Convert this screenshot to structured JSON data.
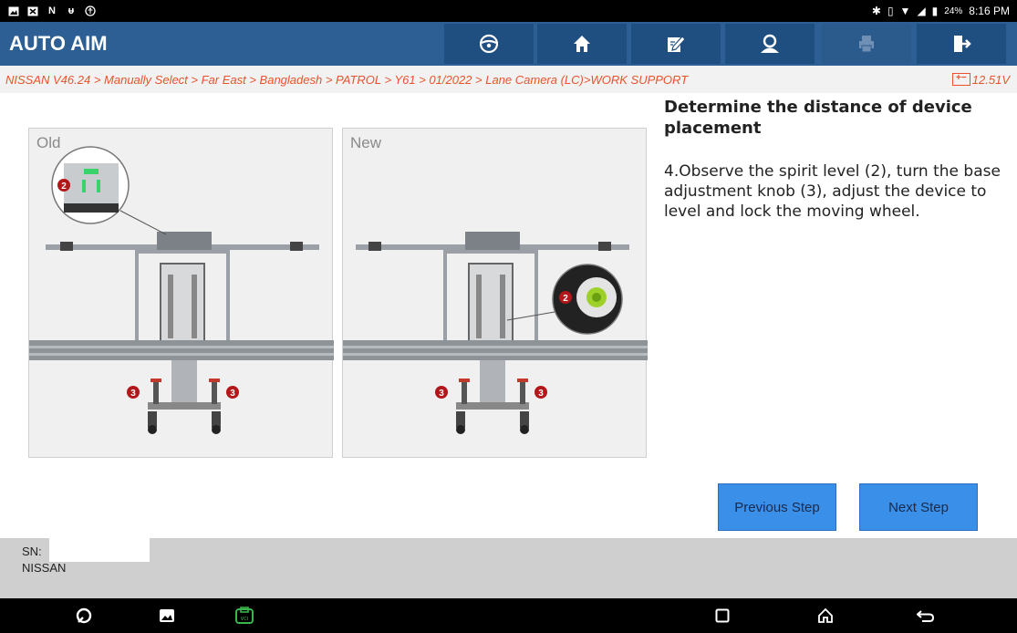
{
  "status_bar": {
    "left_icons": [
      "gallery-icon",
      "app-icon",
      "n-icon",
      "usb-icon",
      "accessibility-icon"
    ],
    "battery_percent": "24%",
    "time": "8:16 PM"
  },
  "header": {
    "title": "AUTO AIM",
    "toolbar": [
      {
        "name": "steering-wheel-icon",
        "enabled": true
      },
      {
        "name": "home-icon",
        "enabled": true
      },
      {
        "name": "edit-icon",
        "enabled": true
      },
      {
        "name": "user-icon",
        "enabled": true
      },
      {
        "name": "print-icon",
        "enabled": false
      },
      {
        "name": "exit-icon",
        "enabled": true
      }
    ]
  },
  "breadcrumb": {
    "path": "NISSAN V46.24 > Manually Select > Far East > Bangladesh > PATROL > Y61 > 01/2022 > Lane Camera (LC)>WORK SUPPORT",
    "voltage": "12.51V"
  },
  "images": {
    "old_label": "Old",
    "new_label": "New",
    "callout_numbers": {
      "level": "2",
      "knob": "3"
    }
  },
  "instruction": {
    "title": "Determine the distance of device placement",
    "text": "4.Observe the spirit level (2), turn the base adjustment knob (3), adjust the device to level and lock the moving wheel."
  },
  "buttons": {
    "previous": "Previous Step",
    "next": "Next Step"
  },
  "footer": {
    "sn_label": "SN:",
    "make": "NISSAN"
  },
  "colors": {
    "header_bg": "#2d5f94",
    "accent_orange": "#e8532c",
    "button_blue": "#3a8fe8"
  }
}
